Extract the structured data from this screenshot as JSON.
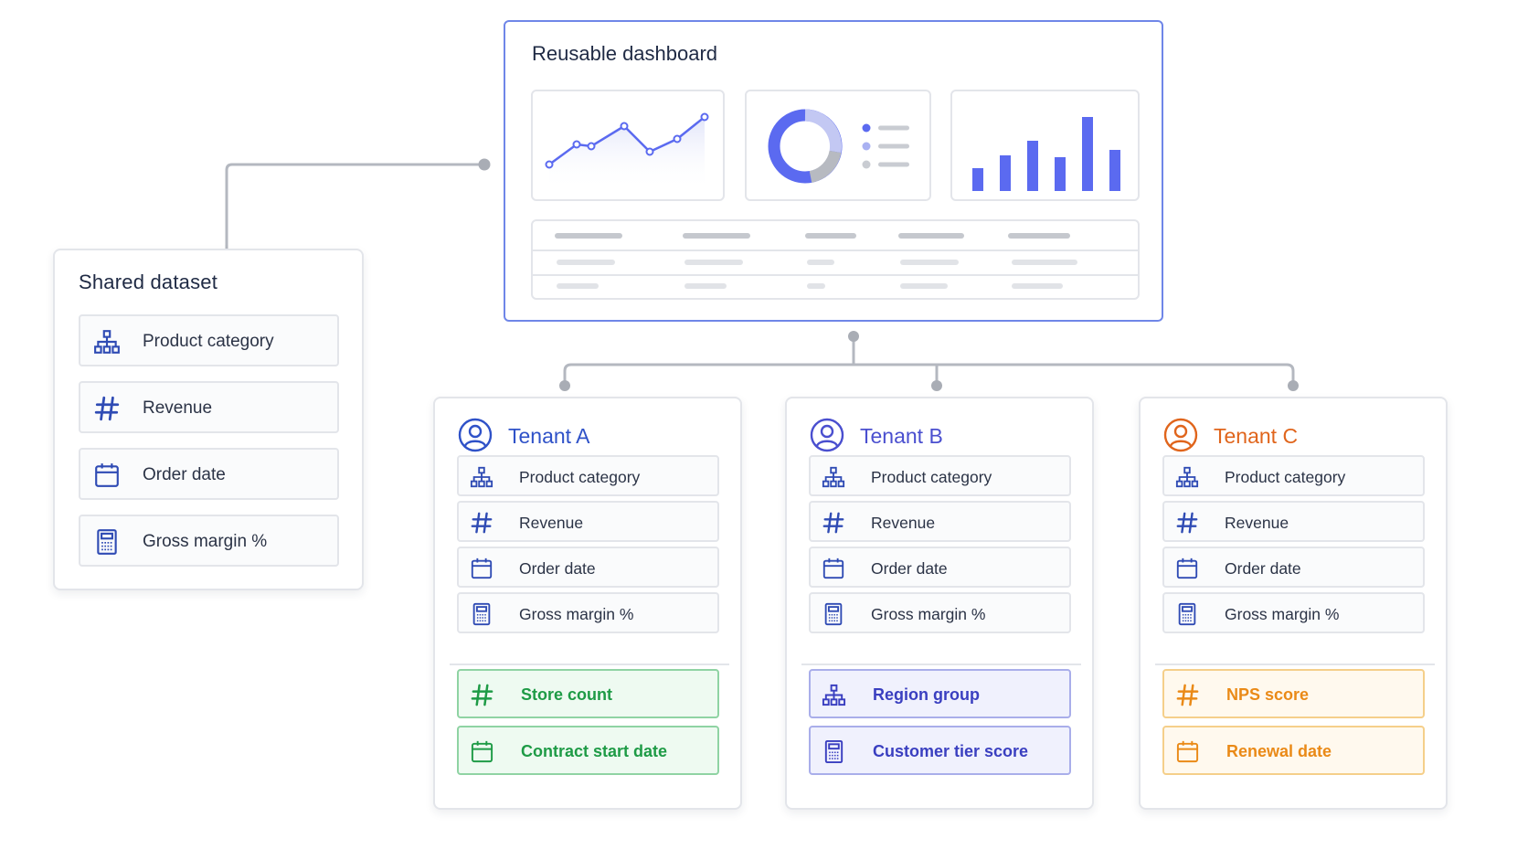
{
  "dashboard": {
    "title": "Reusable dashboard",
    "accent": "#6f86e8",
    "chart_color": "#5b6af0"
  },
  "shared_dataset": {
    "title": "Shared dataset",
    "fields": [
      {
        "label": "Product category",
        "icon": "hierarchy-icon"
      },
      {
        "label": "Revenue",
        "icon": "hash-icon"
      },
      {
        "label": "Order date",
        "icon": "calendar-icon"
      },
      {
        "label": "Gross margin %",
        "icon": "calculator-icon"
      }
    ]
  },
  "tenants": [
    {
      "name": "Tenant A",
      "color": "#2f52c8",
      "fields": [
        {
          "label": "Product category",
          "icon": "hierarchy-icon"
        },
        {
          "label": "Revenue",
          "icon": "hash-icon"
        },
        {
          "label": "Order date",
          "icon": "calendar-icon"
        },
        {
          "label": "Gross margin %",
          "icon": "calculator-icon"
        }
      ],
      "extra_fields": [
        {
          "label": "Store count",
          "icon": "hash-icon"
        },
        {
          "label": "Contract start date",
          "icon": "calendar-icon"
        }
      ],
      "extra_color": "#1e9b46",
      "extra_bg": "#eefaf1",
      "extra_border": "#8fd3a3"
    },
    {
      "name": "Tenant B",
      "color": "#4a4fcf",
      "fields": [
        {
          "label": "Product category",
          "icon": "hierarchy-icon"
        },
        {
          "label": "Revenue",
          "icon": "hash-icon"
        },
        {
          "label": "Order date",
          "icon": "calendar-icon"
        },
        {
          "label": "Gross margin %",
          "icon": "calculator-icon"
        }
      ],
      "extra_fields": [
        {
          "label": "Region group",
          "icon": "hierarchy-icon"
        },
        {
          "label": "Customer tier score",
          "icon": "calculator-icon"
        }
      ],
      "extra_color": "#3a3fc0",
      "extra_bg": "#f0f1fd",
      "extra_border": "#a9aeea"
    },
    {
      "name": "Tenant C",
      "color": "#e0651c",
      "fields": [
        {
          "label": "Product category",
          "icon": "hierarchy-icon"
        },
        {
          "label": "Revenue",
          "icon": "hash-icon"
        },
        {
          "label": "Order date",
          "icon": "calendar-icon"
        },
        {
          "label": "Gross margin %",
          "icon": "calculator-icon"
        }
      ],
      "extra_fields": [
        {
          "label": "NPS score",
          "icon": "hash-icon"
        },
        {
          "label": "Renewal date",
          "icon": "calendar-icon"
        }
      ],
      "extra_color": "#ea8a17",
      "extra_bg": "#fff9ee",
      "extra_border": "#f5cf8a"
    }
  ],
  "field_icon_color": "#2f4bb4"
}
